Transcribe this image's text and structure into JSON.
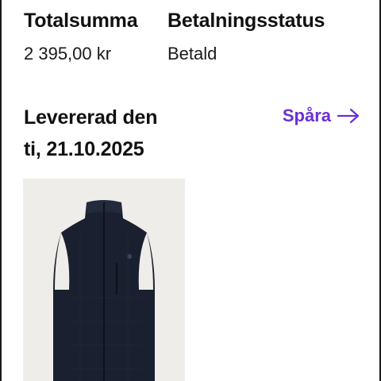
{
  "summary": {
    "total_label": "Totalsumma",
    "total_value": "2 395,00 kr",
    "payment_label": "Betalningsstatus",
    "payment_value": "Betald"
  },
  "delivery": {
    "line1": "Levererad den",
    "line2": "ti, 21.10.2025"
  },
  "track": {
    "label": "Spåra",
    "icon": "arrow-right-icon",
    "color": "#6b2fd6"
  },
  "product": {
    "image_icon": "vest-icon",
    "background": "#eeede9",
    "garment_color": "#1b2030"
  }
}
